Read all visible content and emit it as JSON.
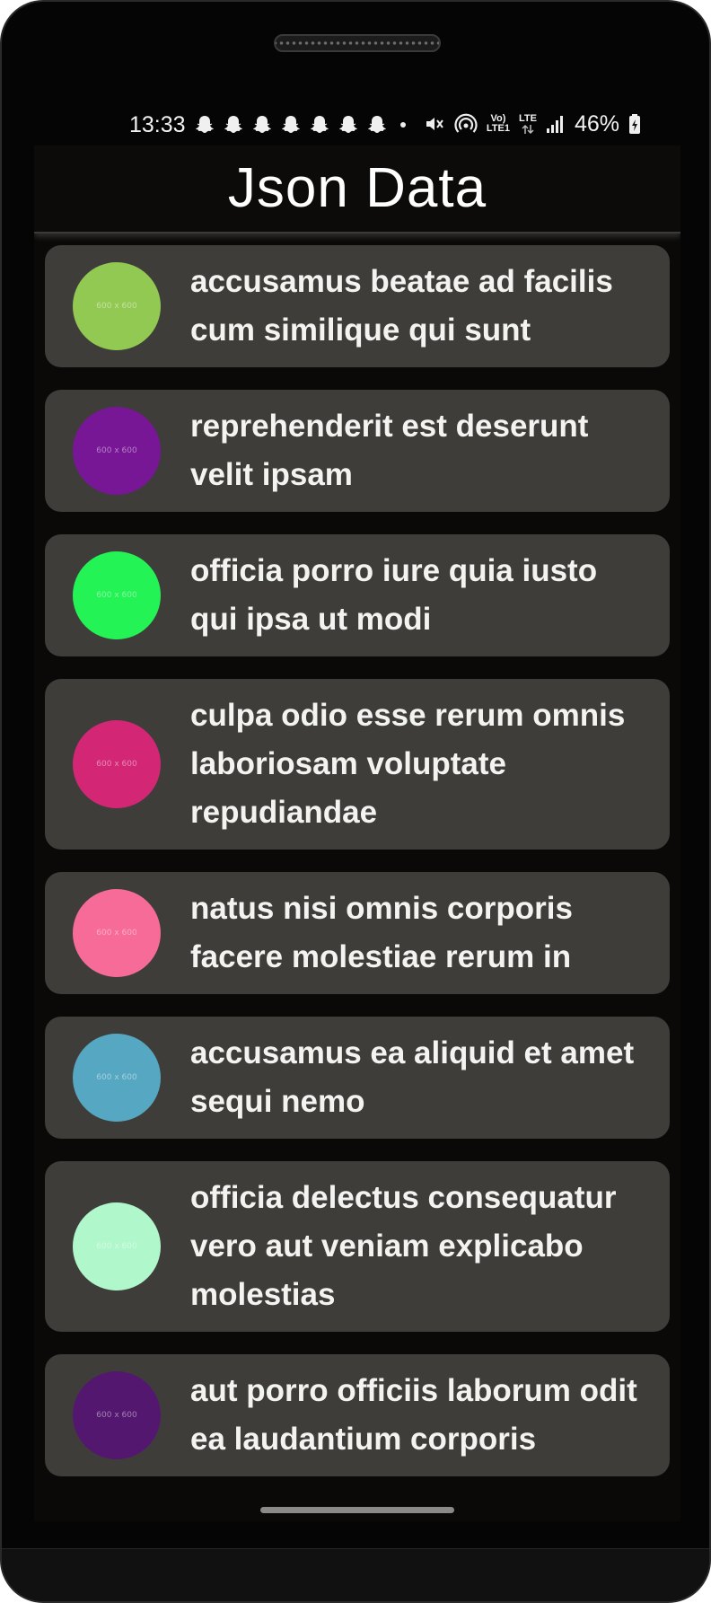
{
  "status_bar": {
    "time": "13:33",
    "notification_icons": [
      "snapchat-icon",
      "snapchat-icon",
      "snapchat-icon",
      "snapchat-icon",
      "snapchat-icon",
      "snapchat-icon",
      "snapchat-icon"
    ],
    "network_label_top": "Vo)",
    "network_label_bottom": "LTE1",
    "lte_label": "LTE",
    "battery": "46%"
  },
  "app_bar": {
    "title": "Json Data"
  },
  "items": [
    {
      "title": "accusamus beatae ad facilis cum similique qui sunt",
      "thumb_text": "600 x 600",
      "color": "#92c952"
    },
    {
      "title": "reprehenderit est deserunt velit ipsam",
      "thumb_text": "600 x 600",
      "color": "#771796"
    },
    {
      "title": "officia porro iure quia iusto qui ipsa ut modi",
      "thumb_text": "600 x 600",
      "color": "#24f355"
    },
    {
      "title": "culpa odio esse rerum omnis laboriosam voluptate repudiandae",
      "thumb_text": "600 x 600",
      "color": "#d32776"
    },
    {
      "title": "natus nisi omnis corporis facere molestiae rerum in",
      "thumb_text": "600 x 600",
      "color": "#f66b97"
    },
    {
      "title": "accusamus ea aliquid et amet sequi nemo",
      "thumb_text": "600 x 600",
      "color": "#56a8c2"
    },
    {
      "title": "officia delectus consequatur vero aut veniam explicabo molestias",
      "thumb_text": "600 x 600",
      "color": "#b0f7cc"
    },
    {
      "title": "aut porro officiis laborum odit ea laudantium corporis",
      "thumb_text": "600 x 600",
      "color": "#54176f"
    }
  ]
}
